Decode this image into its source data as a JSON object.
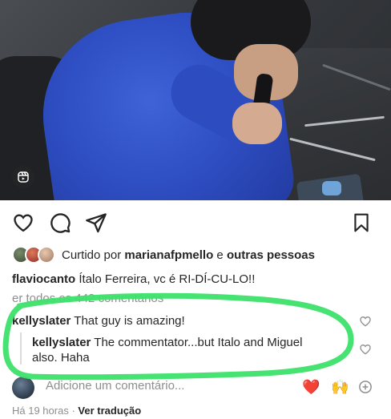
{
  "post": {
    "likes": {
      "prefix": "Curtido por",
      "user": "marianafpmello",
      "joiner": "e",
      "others": "outras pessoas"
    },
    "caption": {
      "username": "flaviocanto",
      "text": "Ítalo Ferreira, vc é RI-DÍ-CU-LO!!"
    },
    "view_all_comments": "er todos os 442 comentários",
    "comments": [
      {
        "username": "kellyslater",
        "text": "That guy is amazing!"
      }
    ],
    "reply": {
      "username": "kellyslater",
      "line1": "The commentator...but Italo and Miguel",
      "line2": "also. Haha"
    },
    "add_comment_placeholder": "Adicione um comentário...",
    "emoji_heart": "❤️",
    "emoji_hands": "🙌",
    "timestamp": "Há 19 horas",
    "separator": "·",
    "translate": "Ver tradução"
  },
  "colors": {
    "annotation_green": "#3ce06a",
    "jacket_blue": "#2f4fc4",
    "muted_text": "#8e8e8e"
  },
  "icons": {
    "reel": "reels-icon",
    "like": "heart-outline-icon",
    "comment": "comment-bubble-icon",
    "share": "paper-plane-icon",
    "save": "bookmark-icon",
    "add_emoji": "plus-circle-icon"
  }
}
